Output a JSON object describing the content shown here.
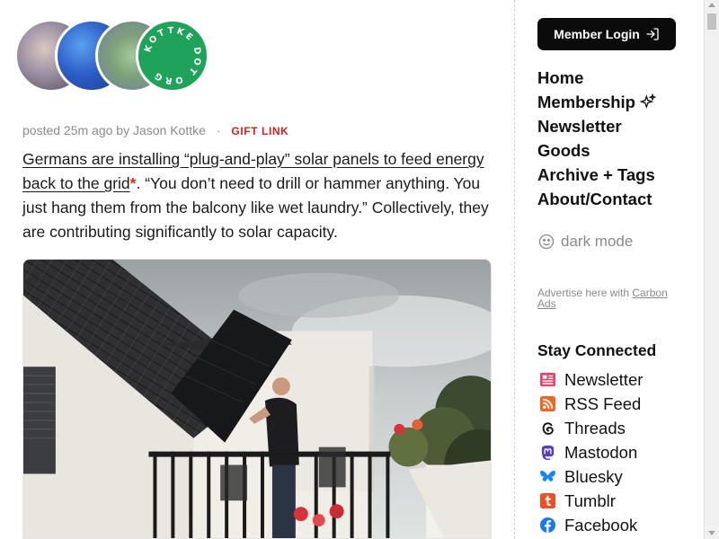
{
  "logo": {
    "text": "KOTTKE DOT ORG"
  },
  "post": {
    "meta": {
      "posted": "posted 25m ago by Jason Kottke",
      "separator": "·",
      "gift_link": "GIFT LINK"
    },
    "link_text": "Germans are installing “plug-and-play” solar panels to feed energy back to the grid",
    "asterisk": "*",
    "body_text": ". “You don’t need to drill or hammer anything. You just hang them from the balcony like wet laundry.” Collectively, they are contributing significantly to solar capacity."
  },
  "sidebar": {
    "login_label": "Member Login",
    "nav": [
      {
        "label": "Home"
      },
      {
        "label": "Membership"
      },
      {
        "label": "Newsletter"
      },
      {
        "label": "Goods"
      },
      {
        "label": "Archive + Tags"
      },
      {
        "label": "About/Contact"
      }
    ],
    "dark_mode": "dark mode",
    "ad_text": "Advertise here with ",
    "ad_link": "Carbon Ads",
    "stay_connected": "Stay Connected",
    "social": [
      {
        "label": "Newsletter",
        "icon": "newsletter-icon",
        "color": "#e8466e"
      },
      {
        "label": "RSS Feed",
        "icon": "rss-icon",
        "color": "#f26522"
      },
      {
        "label": "Threads",
        "icon": "threads-icon",
        "color": "#111111"
      },
      {
        "label": "Mastodon",
        "icon": "mastodon-icon",
        "color": "#563acc"
      },
      {
        "label": "Bluesky",
        "icon": "bluesky-icon",
        "color": "#1185fe"
      },
      {
        "label": "Tumblr",
        "icon": "tumblr-icon",
        "color": "#f04e23"
      },
      {
        "label": "Facebook",
        "icon": "facebook-icon",
        "color": "#1877f2"
      }
    ]
  },
  "colors": {
    "accent_red": "#d0221f",
    "login_bg": "#0b0b0b",
    "muted_text": "#8a8a8a"
  }
}
